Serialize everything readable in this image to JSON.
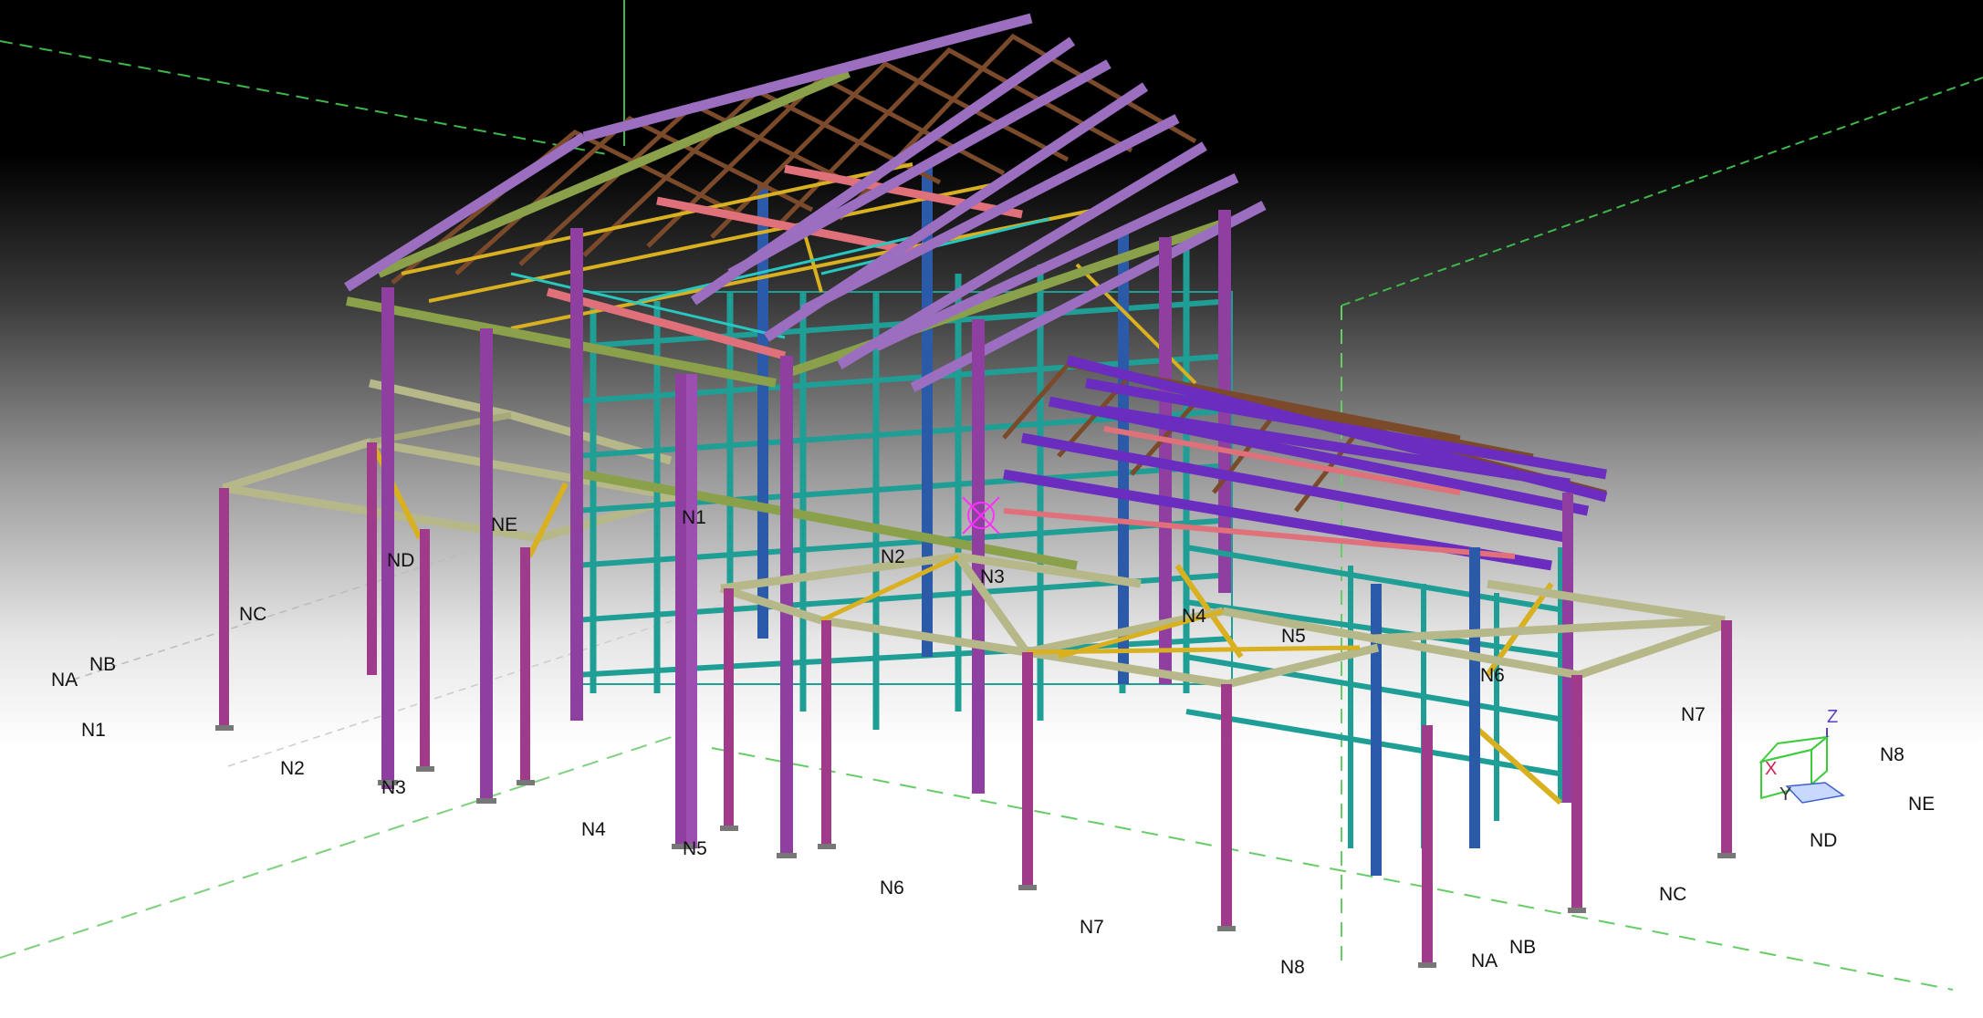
{
  "viewport": {
    "background_top": "#000000",
    "background_bottom": "#ffffff"
  },
  "grid_labels_left": {
    "na": "NA",
    "nb": "NB",
    "nc": "NC",
    "nd": "ND",
    "ne": "NE",
    "n1": "N1",
    "n2": "N2",
    "n3": "N3",
    "n4": "N4",
    "n5": "N5"
  },
  "grid_labels_structure": {
    "n1": "N1",
    "n2": "N2",
    "n3": "N3",
    "n4": "N4",
    "n5": "N5",
    "n6": "N6",
    "n7": "N7"
  },
  "grid_labels_front": {
    "n6": "N6",
    "n7": "N7",
    "n8": "N8",
    "na": "NA",
    "nb": "NB",
    "nc": "NC"
  },
  "grid_labels_right": {
    "n8": "N8",
    "ne": "NE",
    "nd": "ND"
  },
  "view_cube": {
    "z": "Z",
    "x": "X",
    "y": "Y"
  },
  "member_colors": {
    "column": "#8e3fa0",
    "column_alt": "#a03b8c",
    "rafter": "#8d5cb0",
    "purlin": "#6a2dbf",
    "girt": "#1f9e96",
    "brace": "#d8b020",
    "truss": "#7a4a2a",
    "beam_green": "#8aa04a",
    "beam_olive": "#b7b88a",
    "tie_red": "#e0707a",
    "bracing_cyan": "#28c7c0",
    "column_blue": "#2a5aa8"
  }
}
